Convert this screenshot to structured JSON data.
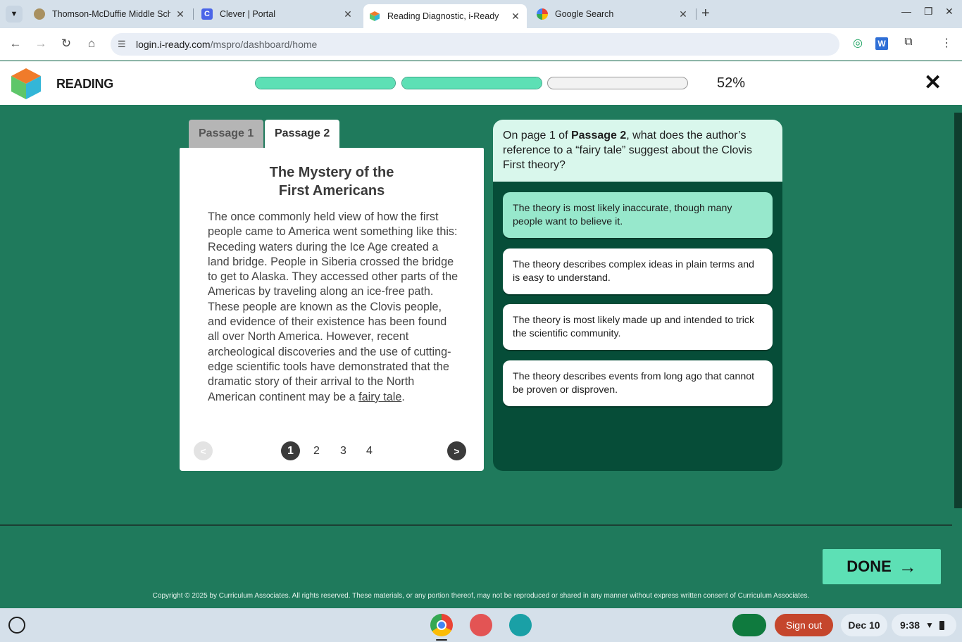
{
  "browser": {
    "tabs": [
      {
        "title": "Thomson-McDuffie Middle Sch",
        "active": false
      },
      {
        "title": "Clever | Portal",
        "active": false
      },
      {
        "title": "Reading Diagnostic, i-Ready",
        "active": true
      },
      {
        "title": "Google Search",
        "active": false
      }
    ],
    "url_host": "login.i-ready.com",
    "url_path": "/mspro/dashboard/home"
  },
  "app": {
    "title": "READING",
    "progress": [
      1.0,
      1.0,
      0.0
    ],
    "progress_percent": "52%"
  },
  "passage": {
    "tabs": [
      "Passage 1",
      "Passage 2"
    ],
    "active_tab": "Passage 2",
    "title_line1": "The Mystery of the",
    "title_line2": "First Americans",
    "body": "The once commonly held view of how the first people came to America went something like this: Receding waters during the Ice Age created a land bridge. People in Siberia crossed the bridge to get to Alaska. They accessed other parts of the Americas by traveling along an ice-free path. These people are known as the Clovis people, and evidence of their existence has been found all over North America. However, recent archeological discoveries and the use of cutting-edge scientific tools have demonstrated that the dramatic story of their arrival to the North American continent may be a ",
    "body_link": "fairy tale",
    "body_end": ".",
    "pagination": {
      "prev": "<",
      "next": ">",
      "pages": [
        "1",
        "2",
        "3",
        "4"
      ],
      "current": "1"
    }
  },
  "question": {
    "prefix": "On page 1 of ",
    "bold": "Passage 2",
    "suffix": ", what does the author’s reference to a “fairy tale” suggest about the Clovis First theory?",
    "answers": [
      {
        "text": "The theory is most likely inaccurate, though many people want to believe it.",
        "selected": true
      },
      {
        "text": "The theory describes complex ideas in plain terms and is easy to understand.",
        "selected": false
      },
      {
        "text": "The theory is most likely made up and intended to trick the scientific community.",
        "selected": false
      },
      {
        "text": "The theory describes events from long ago that cannot be proven or disproven.",
        "selected": false
      }
    ]
  },
  "footer": {
    "done_label": "DONE",
    "copyright": "Copyright © 2025 by Curriculum Associates. All rights reserved. These materials, or any portion thereof, may not be reproduced or shared in any manner without express written consent of Curriculum Associates."
  },
  "shelf": {
    "signout": "Sign out",
    "date": "Dec 10",
    "time": "9:38"
  },
  "colors": {
    "background": "#1f7a5c",
    "accent": "#5de0b5",
    "question_panel": "#064d38",
    "question_header": "#d9f7ec",
    "selected_answer": "#97e8cc",
    "signout": "#c5462c"
  }
}
